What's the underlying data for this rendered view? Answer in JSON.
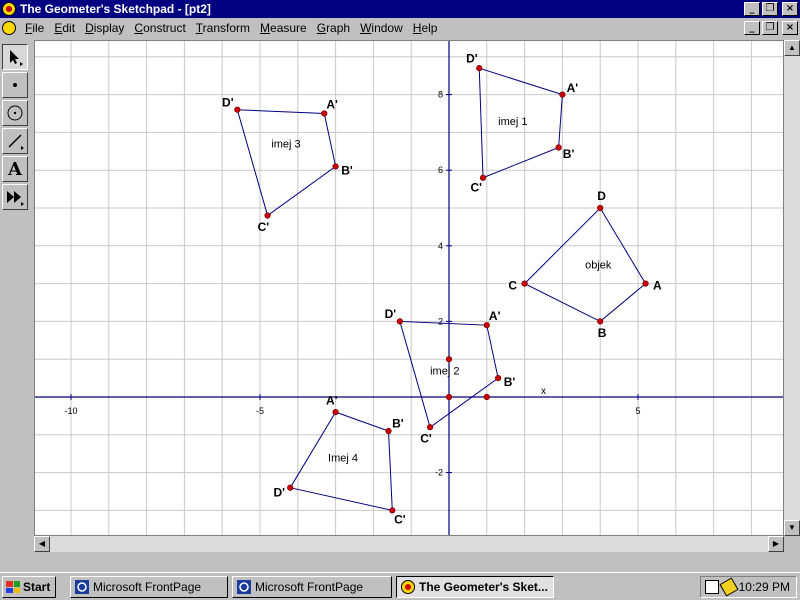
{
  "window": {
    "title": "The Geometer's Sketchpad - [pt2]"
  },
  "menu": [
    {
      "accel": "F",
      "rest": "ile"
    },
    {
      "accel": "E",
      "rest": "dit"
    },
    {
      "accel": "D",
      "rest": "isplay"
    },
    {
      "accel": "C",
      "rest": "onstruct"
    },
    {
      "accel": "T",
      "rest": "ransform"
    },
    {
      "accel": "M",
      "rest": "easure"
    },
    {
      "accel": "G",
      "rest": "raph"
    },
    {
      "accel": "W",
      "rest": "indow"
    },
    {
      "accel": "H",
      "rest": "elp"
    }
  ],
  "tools": [
    "arrow-tool-icon",
    "point-tool-icon",
    "compass-tool-icon",
    "straightedge-tool-icon",
    "text-tool-icon",
    "script-tool-icon"
  ],
  "tool_labels": {
    "text": "A"
  },
  "graph": {
    "x_ticks": [
      -10,
      -5,
      5
    ],
    "y_ticks": [
      8,
      6,
      4,
      2,
      -2
    ],
    "x_axis_label": "x",
    "axis_color": "#000080",
    "shape_color": "#000080",
    "point_color": "#cc0000",
    "shapes": [
      {
        "name": "objek",
        "label_pos": [
          3.6,
          3.4
        ],
        "points": [
          {
            "label": "A",
            "x": 5.2,
            "y": 3.0
          },
          {
            "label": "B",
            "x": 4.0,
            "y": 2.0
          },
          {
            "label": "C",
            "x": 2.0,
            "y": 3.0
          },
          {
            "label": "D",
            "x": 4.0,
            "y": 5.0
          }
        ]
      },
      {
        "name": "imej 1",
        "label_pos": [
          1.3,
          7.2
        ],
        "points": [
          {
            "label": "A'",
            "x": 3.0,
            "y": 8.0
          },
          {
            "label": "B'",
            "x": 2.9,
            "y": 6.6
          },
          {
            "label": "C'",
            "x": 0.9,
            "y": 5.8
          },
          {
            "label": "D'",
            "x": 0.8,
            "y": 8.7
          }
        ]
      },
      {
        "name": "imej 2",
        "label_pos": [
          -0.5,
          0.6
        ],
        "points": [
          {
            "label": "A'",
            "x": 1.0,
            "y": 1.9
          },
          {
            "label": "B'",
            "x": 1.3,
            "y": 0.5
          },
          {
            "label": "C'",
            "x": -0.5,
            "y": -0.8
          },
          {
            "label": "D'",
            "x": -1.3,
            "y": 2.0
          }
        ]
      },
      {
        "name": "imej 3",
        "label_pos": [
          -4.7,
          6.6
        ],
        "points": [
          {
            "label": "A'",
            "x": -3.3,
            "y": 7.5
          },
          {
            "label": "B'",
            "x": -3.0,
            "y": 6.1
          },
          {
            "label": "C'",
            "x": -4.8,
            "y": 4.8
          },
          {
            "label": "D'",
            "x": -5.6,
            "y": 7.6
          }
        ]
      },
      {
        "name": "Imej 4",
        "label_pos": [
          -3.2,
          -1.7
        ],
        "points": [
          {
            "label": "A'",
            "x": -3.0,
            "y": -0.4
          },
          {
            "label": "B'",
            "x": -1.6,
            "y": -0.9
          },
          {
            "label": "C'",
            "x": -1.5,
            "y": -3.0
          },
          {
            "label": "D'",
            "x": -4.2,
            "y": -2.4
          }
        ]
      }
    ],
    "extra_points": [
      {
        "x": 0,
        "y": 1
      },
      {
        "x": 0,
        "y": 0
      },
      {
        "x": 1,
        "y": 0
      }
    ]
  },
  "taskbar": {
    "start_label": "Start",
    "tasks": [
      {
        "label": "Microsoft FrontPage",
        "active": false
      },
      {
        "label": "Microsoft FrontPage",
        "active": false
      },
      {
        "label": "The Geometer's Sket...",
        "active": true
      }
    ],
    "clock": "10:29 PM"
  }
}
